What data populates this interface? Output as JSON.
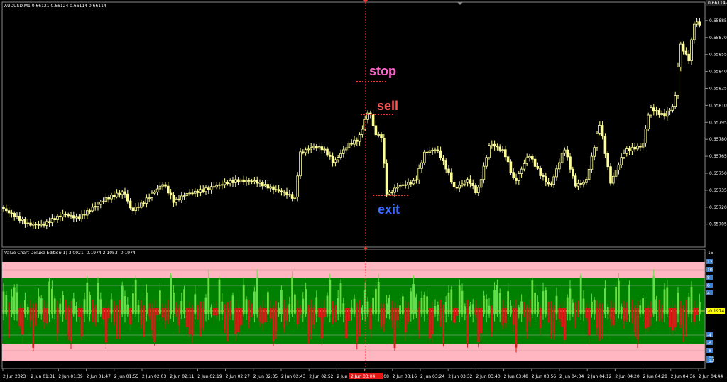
{
  "main": {
    "symbol_info": "AUDUSD,M1  0.66121 0.66124 0.66114 0.66114",
    "price_scale": [
      "0.65900",
      "0.65885",
      "0.65870",
      "0.65855",
      "0.65840",
      "0.65825",
      "0.65810",
      "0.65795",
      "0.65780",
      "0.65765",
      "0.65750",
      "0.65735",
      "0.65720",
      "0.65705"
    ],
    "current_price": "0.66114",
    "annotations": {
      "stop": "stop",
      "sell": "sell",
      "exit": "exit"
    }
  },
  "indicator": {
    "info": "Value Chart Deluxe Edition(1) 3.0921 -0.1974 2.1053 -0.1974",
    "scale_top": "15",
    "scale_labels": [
      "12",
      "10",
      "8",
      "6",
      "4",
      "-4",
      "-6",
      "-8",
      "-10",
      "-12"
    ],
    "current_value": "-0.1974"
  },
  "time_axis": {
    "labels": [
      "2 Jun 2023",
      "2 Jun 01:31",
      "2 Jun 01:39",
      "2 Jun 01:47",
      "2 Jun 01:55",
      "2 Jun 02:03",
      "2 Jun 02:11",
      "2 Jun 02:19",
      "2 Jun 02:27",
      "2 Jun 02:35",
      "2 Jun 02:43",
      "2 Jun 02:52",
      "2 Jun 03:00",
      "2 Jun 03:08",
      "2 Jun 03:16",
      "2 Jun 03:24",
      "2 Jun 03:32",
      "2 Jun 03:40",
      "2 Jun 03:48",
      "2 Jun 03:56",
      "2 Jun 04:04",
      "2 Jun 04:12",
      "2 Jun 04:20",
      "2 Jun 04:28",
      "2 Jun 04:36",
      "2 Jun 04:44"
    ],
    "highlight_label": "2 Jun 03:04"
  },
  "colors": {
    "bull_candle": "#ffff99",
    "bear_candle": "#ffff99",
    "band_outer": "#ffb6c1",
    "band_inner": "#008000",
    "bar_up": "#66dd44",
    "bar_down": "#e21818",
    "stop": "#ff66cc",
    "sell": "#ff5555",
    "exit": "#3b6cff",
    "crosshair": "#ff3030"
  }
}
